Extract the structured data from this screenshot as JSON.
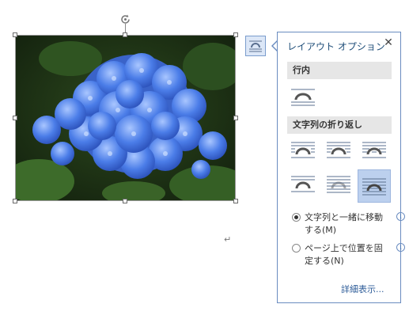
{
  "panel": {
    "title": "レイアウト オプション",
    "close_label": "✕",
    "section_inline": "行内",
    "section_wrap": "文字列の折り返し",
    "radio_move": "文字列と一緒に移動する(M)",
    "radio_fix": "ページ上で位置を固定する(N)",
    "info_glyph": "i",
    "more_link": "詳細表示..."
  },
  "document": {
    "paragraph_mark": "↵"
  },
  "icons": {
    "layout_options_button": "layout-options-icon",
    "rotate_handle": "rotate-handle-icon",
    "inline": "wrap-inline-icon",
    "wrap": [
      "wrap-square-icon",
      "wrap-tight-icon",
      "wrap-through-icon",
      "wrap-top-bottom-icon",
      "wrap-behind-text-icon",
      "wrap-in-front-of-text-icon"
    ]
  },
  "state": {
    "selected_wrap": "wrap-in-front-of-text",
    "selected_radio": "move-with-text"
  },
  "colors": {
    "accent": "#1f4e79",
    "selected_bg": "#bcd0ee",
    "section_bg": "#e6e6e6",
    "link": "#2e5c99"
  }
}
